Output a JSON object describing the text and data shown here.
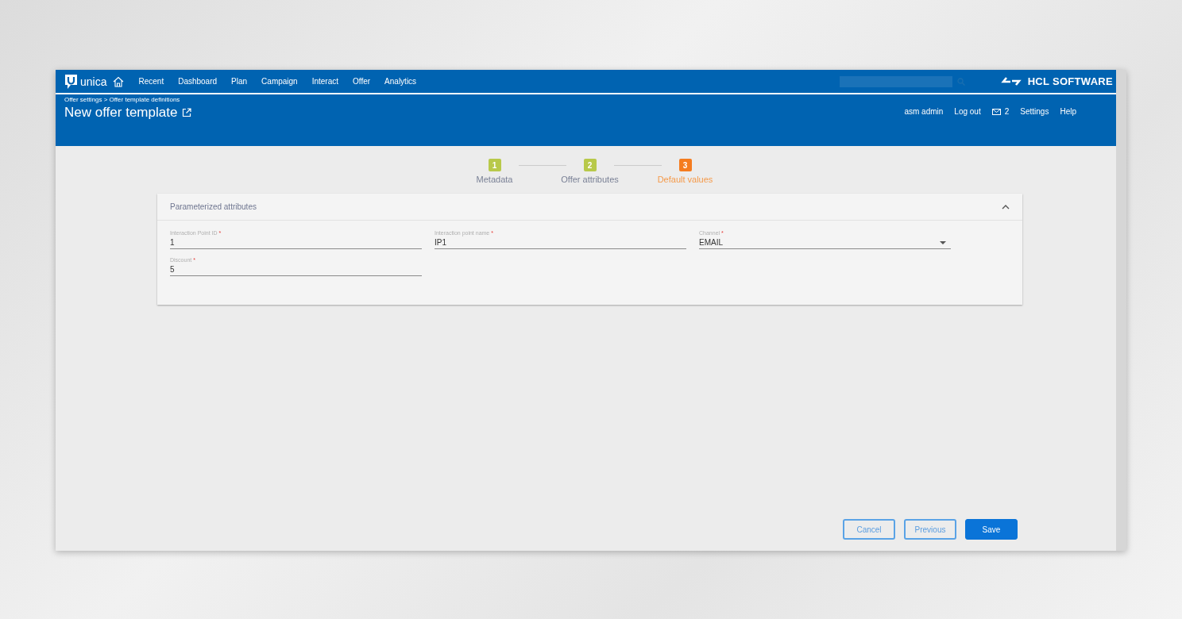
{
  "app": {
    "product": "unica",
    "brand": "HCL SOFTWARE"
  },
  "nav": {
    "items": [
      "Recent",
      "Dashboard",
      "Plan",
      "Campaign",
      "Interact",
      "Offer",
      "Analytics"
    ]
  },
  "header": {
    "breadcrumb": "Offer settings > Offer template definitions",
    "title": "New offer template"
  },
  "user_menu": {
    "user": "asm admin",
    "logout": "Log out",
    "messages": "2",
    "settings": "Settings",
    "help": "Help"
  },
  "steps": [
    {
      "number": "1",
      "label": "Metadata",
      "selected": false
    },
    {
      "number": "2",
      "label": "Offer attributes",
      "selected": false
    },
    {
      "number": "3",
      "label": "Default values",
      "selected": true
    }
  ],
  "panel": {
    "title": "Parameterized attributes",
    "expanded": true,
    "fields": [
      {
        "kind": "input",
        "label": "Interaction Point ID",
        "required_mark": "*",
        "value": "1"
      },
      {
        "kind": "input",
        "label": "Interaction point name",
        "required_mark": "*",
        "value": "IP1"
      },
      {
        "kind": "select",
        "label": "Channel",
        "required_mark": "*",
        "value": "EMAIL"
      },
      {
        "kind": "input",
        "label": "Discount",
        "required_mark": "*",
        "value": "5"
      }
    ]
  },
  "buttons": [
    {
      "kind": "outline",
      "label": "Cancel"
    },
    {
      "kind": "outline",
      "label": "Previous"
    },
    {
      "kind": "primary",
      "label": "Save"
    }
  ]
}
